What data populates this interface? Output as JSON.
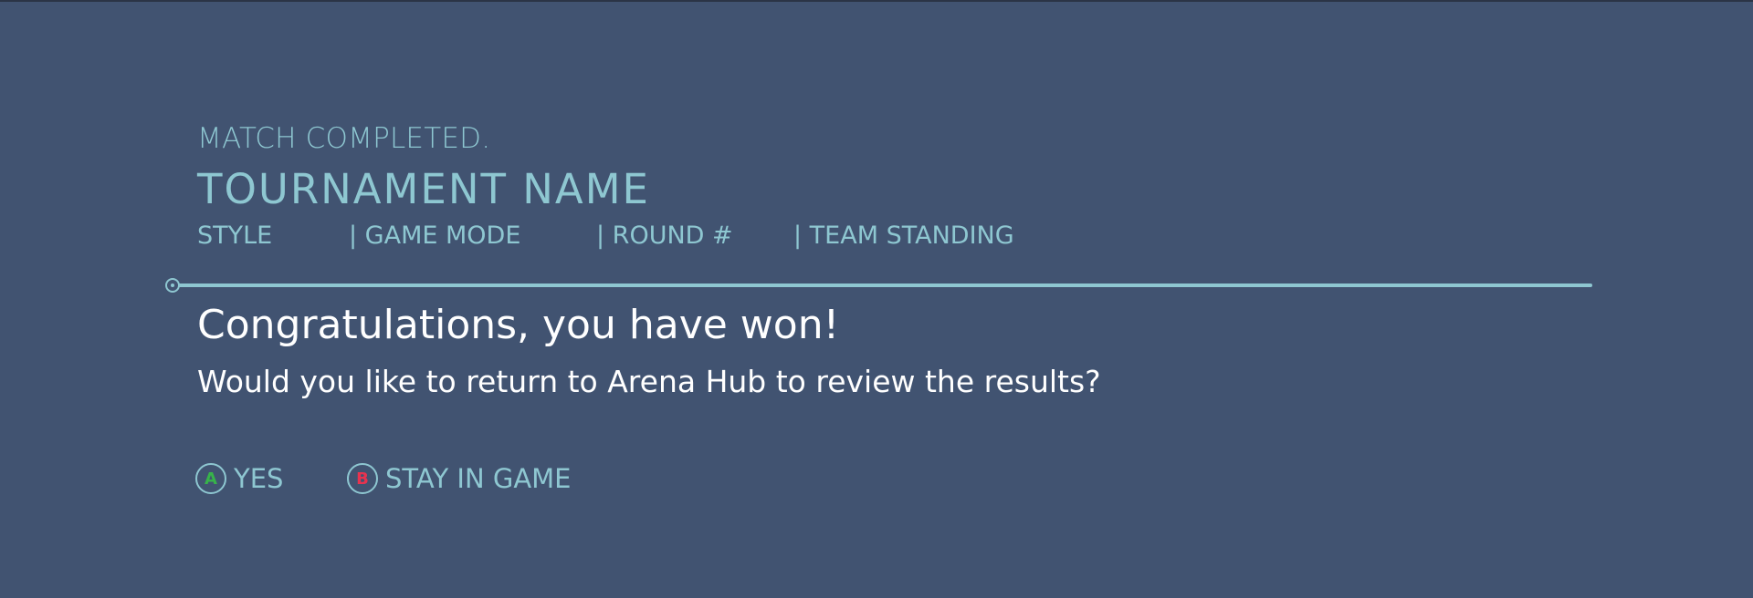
{
  "header": {
    "status": "MATCH COMPLETED.",
    "tournament_name": "TOURNAMENT NAME",
    "meta": {
      "style": "STYLE",
      "game_mode": "| GAME MODE",
      "round": "| ROUND #",
      "team_standing": "| TEAM STANDING"
    }
  },
  "message": {
    "headline": "Congratulations, you have won!",
    "question": "Would you like to return to Arena Hub to review the results?"
  },
  "actions": {
    "yes": {
      "glyph": "A",
      "glyph_color": "#37b34a",
      "label": "YES"
    },
    "stay": {
      "glyph": "B",
      "glyph_color": "#e8334f",
      "label": "STAY IN GAME"
    }
  },
  "colors": {
    "background": "#415371",
    "accent": "#8ec7d1",
    "text": "#ffffff"
  }
}
